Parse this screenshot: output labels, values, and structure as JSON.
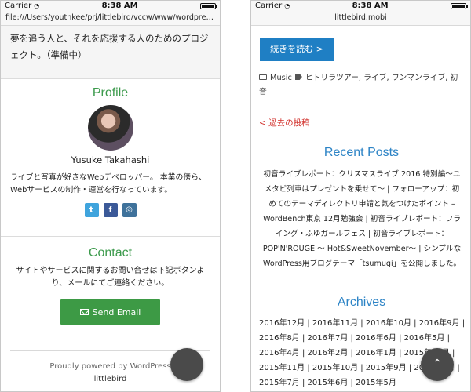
{
  "left": {
    "status": {
      "carrier": "Carrier",
      "time": "8:38 AM"
    },
    "url": "file:///Users/youthkee/prj/littlebird/vccw/www/wordpress/backup/inc",
    "intro": "夢を追う人と、それを応援する人のためのプロジェクト。（準備中）",
    "profile": {
      "title": "Profile",
      "name": "Yusuke Takahashi",
      "bio": "ライブと写真が好きなWebデベロッパー。 本業の傍ら、Webサービスの制作・運営を行なっています。",
      "socials": [
        {
          "name": "twitter",
          "glyph": "t"
        },
        {
          "name": "facebook",
          "glyph": "f"
        },
        {
          "name": "instagram",
          "glyph": "◎"
        }
      ]
    },
    "contact": {
      "title": "Contact",
      "text": "サイトやサービスに関するお問い合せは下記ボタンより、メールにてご連絡ください。",
      "button": "Send Email"
    },
    "footer": {
      "powered": "Proudly powered by WordPress",
      "site": "littlebird"
    }
  },
  "right": {
    "status": {
      "carrier": "Carrier",
      "time": "8:38 AM"
    },
    "url": "littlebird.mobi",
    "read_more": "続きを読む >",
    "meta": {
      "category": "Music",
      "tags": "ヒトリラツアー, ライブ, ワンマンライブ, 初音"
    },
    "prev_link": "< 過去の投稿",
    "recent_title": "Recent Posts",
    "recent_posts": "初音ライブレポート：クリスマスライブ 2016 特別編〜ユメタビ列車はプレゼントを乗せて〜 | フォローアップ：初めてのテーマディレクトリ申請と気をつけたポイント – WordBench東京 12月勉強会 | 初音ライブレポート：フライング・ふゆガールフェス | 初音ライブレポート：POP'N'ROUGE 〜 Hot&SweetNovember〜 | シンプルなWordPress用ブログテーマ「tsumugi」を公開しました。",
    "archives_title": "Archives",
    "archives": "2016年12月 | 2016年11月 | 2016年10月 | 2016年9月 | 2016年8月 | 2016年7月 | 2016年6月 | 2016年5月 | 2016年4月 | 2016年2月 | 2016年1月 | 2015年12月 | 2015年11月 | 2015年10月 | 2015年9月 | 2015年8月 | 2015年7月 | 2015年6月 | 2015年5月"
  },
  "colors": {
    "accent_green": "#3c9a4c",
    "button_blue": "#1f7fc4",
    "heading_blue": "#2d84c6",
    "link_red": "#d2322d"
  },
  "icons": [
    "wifi-icon",
    "battery-icon",
    "avatar",
    "twitter-icon",
    "facebook-icon",
    "instagram-icon",
    "mail-icon",
    "folder-icon",
    "tag-icon",
    "chevron-up-icon"
  ]
}
